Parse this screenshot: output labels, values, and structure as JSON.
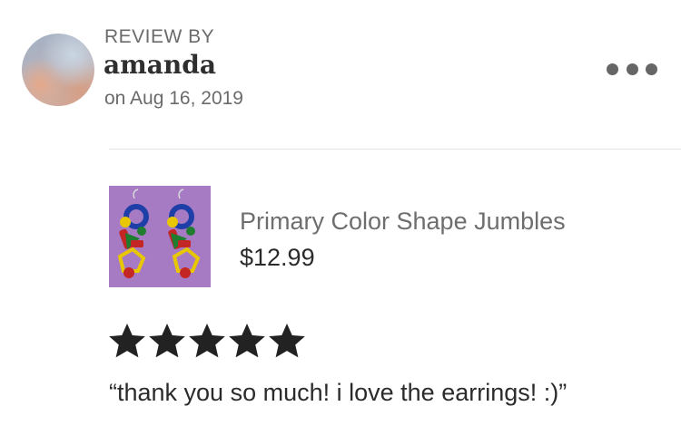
{
  "review": {
    "label": "REVIEW BY",
    "reviewer_name": "amanda",
    "date": "on Aug 16, 2019",
    "rating": 5,
    "max_rating": 5,
    "text": "“thank you so much! i love the earrings! :)”"
  },
  "product": {
    "title": "Primary Color Shape Jumbles",
    "price": "$12.99"
  },
  "icons": {
    "more": "more-horizontal-icon",
    "star": "star-icon",
    "avatar": "avatar-photo",
    "product": "product-photo"
  },
  "colors": {
    "star_fill": "#222222",
    "product_bg": "#a67bc4"
  }
}
